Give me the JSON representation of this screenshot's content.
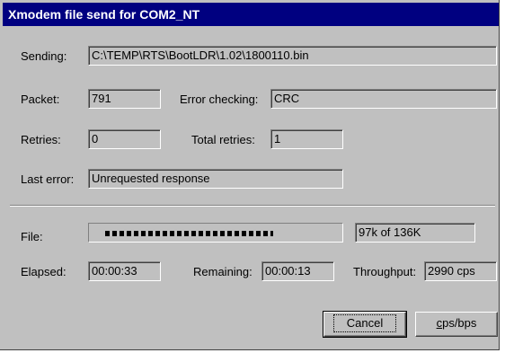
{
  "window": {
    "title": "Xmodem file send for COM2_NT"
  },
  "sending": {
    "label": "Sending:",
    "value": "C:\\TEMP\\RTS\\BootLDR\\1.02\\1800110.bin"
  },
  "packet": {
    "label": "Packet:",
    "value": "791"
  },
  "error_checking": {
    "label": "Error checking:",
    "value": "CRC"
  },
  "retries": {
    "label": "Retries:",
    "value": "0"
  },
  "total_retries": {
    "label": "Total retries:",
    "value": "1"
  },
  "last_error": {
    "label": "Last error:",
    "value": "Unrequested response"
  },
  "file": {
    "label": "File:",
    "progress_fraction": 0.71,
    "size_text": "97k of 136K"
  },
  "elapsed": {
    "label": "Elapsed:",
    "value": "00:00:33"
  },
  "remaining": {
    "label": "Remaining:",
    "value": "00:00:13"
  },
  "throughput": {
    "label": "Throughput:",
    "value": "2990 cps"
  },
  "buttons": {
    "cancel": "Cancel",
    "cps_underline": "c",
    "cps_rest": "ps/bps"
  }
}
